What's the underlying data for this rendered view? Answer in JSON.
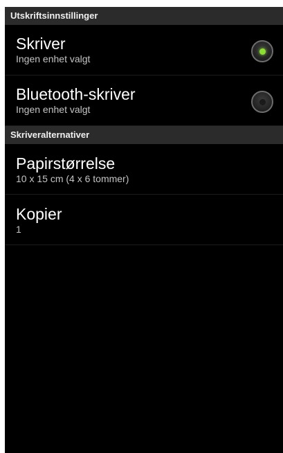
{
  "header": {
    "print_settings": "Utskriftsinnstillinger",
    "printer_options": "Skriveralternativer"
  },
  "printers": [
    {
      "title": "Skriver",
      "subtitle": "Ingen enhet valgt",
      "selected": true
    },
    {
      "title": "Bluetooth-skriver",
      "subtitle": "Ingen enhet valgt",
      "selected": false
    }
  ],
  "options": [
    {
      "title": "Papirstørrelse",
      "subtitle": "10 x 15 cm (4 x 6 tommer)"
    },
    {
      "title": "Kopier",
      "subtitle": "1"
    }
  ],
  "colors": {
    "radio_checked": "#8be033",
    "background": "#000000",
    "header_bg": "#2b2b2b"
  }
}
